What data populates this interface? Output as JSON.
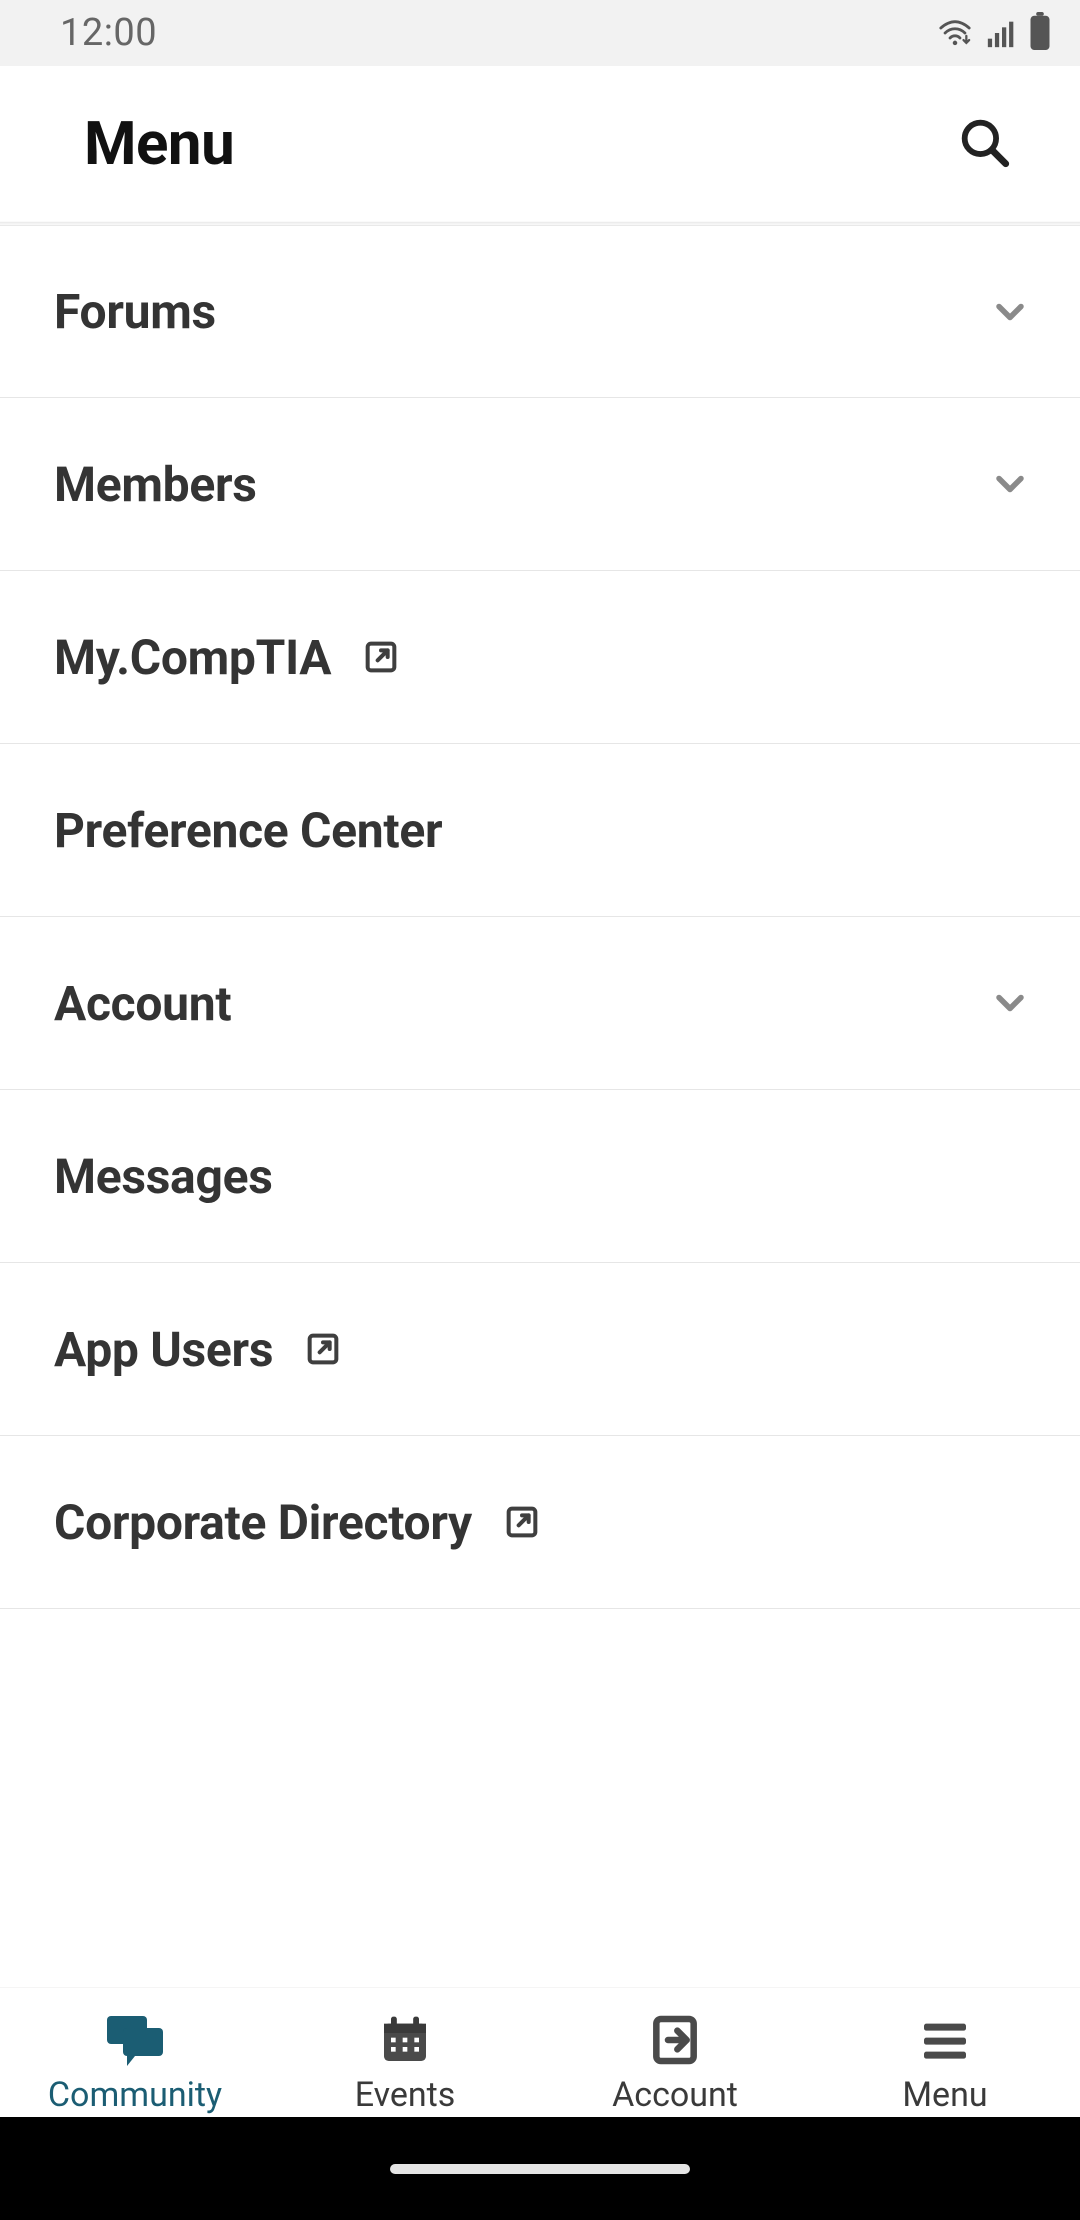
{
  "status_bar": {
    "time": "12:00"
  },
  "header": {
    "title": "Menu"
  },
  "menu": {
    "items": [
      {
        "label": "Forums",
        "expandable": true
      },
      {
        "label": "Members",
        "expandable": true
      },
      {
        "label": "My.CompTIA",
        "external": true
      },
      {
        "label": "Preference Center"
      },
      {
        "label": "Account",
        "expandable": true
      },
      {
        "label": "Messages"
      },
      {
        "label": "App Users",
        "external": true
      },
      {
        "label": "Corporate Directory",
        "external": true
      }
    ]
  },
  "bottom_nav": {
    "items": [
      {
        "label": "Community",
        "active": true
      },
      {
        "label": "Events",
        "active": false
      },
      {
        "label": "Account",
        "active": false
      },
      {
        "label": "Menu",
        "active": false
      }
    ]
  },
  "colors": {
    "accent": "#1b5d73",
    "text_primary": "#343434",
    "divider": "#e6e6e6",
    "icon_muted": "#8a8a8a"
  }
}
